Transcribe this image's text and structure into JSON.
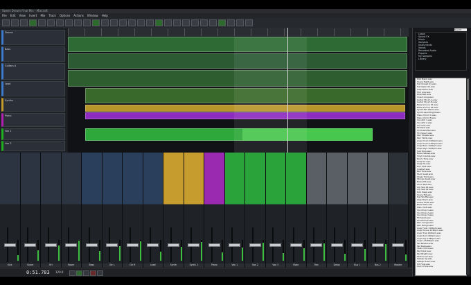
{
  "window": {
    "title": "Sweet Dream Final Mix - Mixcraft"
  },
  "menu": [
    "File",
    "Edit",
    "View",
    "Insert",
    "Mix",
    "Track",
    "Options",
    "Actions",
    "Window",
    "Help"
  ],
  "tracks": [
    {
      "name": "Drums",
      "color": "#3b7acb"
    },
    {
      "name": "Bass",
      "color": "#3b7acb"
    },
    {
      "name": "Guitars A",
      "color": "#3b7acb"
    },
    {
      "name": "Lead",
      "color": "#3b7acb"
    },
    {
      "name": "Synths",
      "color": "#c49b29"
    },
    {
      "name": "Piano",
      "color": "#b21fb1"
    },
    {
      "name": "Vox 1",
      "color": "#1fb21f"
    },
    {
      "name": "Vox 2",
      "color": "#1fb21f"
    }
  ],
  "browser": {
    "search_label": "Search",
    "tree": [
      "Loops",
      "Sound FX",
      "Music",
      "Samples",
      "Instruments",
      "Vocals",
      "Recorded Audio",
      "Exports",
      "My Samples",
      "Library"
    ],
    "files": [
      "Kick Basic.wav",
      "Snare Tight.wav",
      "Hat Closed 01.wav",
      "Hat Open 02.wav",
      "Clap Room.wav",
      "Tom Low.wav",
      "Ride Bell.wav",
      "Crash Long.wav",
      "Guitar Strum A.wav",
      "Guitar Strum B.wav",
      "Bass Groove 01.wav",
      "Bass Groove 02.wav",
      "Synth Pad Warm.wav",
      "Synth Lead Bright.wav",
      "Piano Chord C.wav",
      "Piano Chord F.wav",
      "Vox Ahh 1.wav",
      "Vox Ahh 2.wav",
      "Vox Ooh.wav",
      "FX Riser.wav",
      "FX Downlifter.wav",
      "FX Impact.wav",
      "Perc Shaker.wav",
      "Perc Tamb.wav",
      "Loop Drum 100bpm.wav",
      "Loop Drum 120bpm.wav",
      "Loop Bass 120bpm.wav",
      "Loop Keys 120bpm.wav",
      "Sub Drop.wav",
      "Noise Sweep.wav",
      "Vinyl Crackle.wav",
      "Room Tone.wav",
      "Snap 01.wav",
      "Snap 02.wav",
      "Rim Shot.wav",
      "Cowbell.wav",
      "Bell Tone.wav",
      "Pluck Lead.wav",
      "Organ Hold.wav",
      "Strings Swell.wav",
      "Brass Hit.wav",
      "Choir Pad.wav",
      "Arp Seq 01.wav",
      "Arp Seq 02.wav",
      "Kick Deep.wav",
      "Snare Fat.wav",
      "Hat Shuffle.wav",
      "Clap Stack.wav",
      "Guitar Mute.wav",
      "Bass Slide.wav",
      "Piano Soft.wav",
      "Vox Chop 1.wav",
      "Vox Chop 2.wav",
      "Vox Chop 3.wav",
      "FX Swell.wav",
      "FX Whoosh.wav",
      "Perc Conga.wav",
      "Perc Bongo.wav",
      "Loop Funk 110bpm.wav",
      "Loop House 124bpm.wav",
      "Loop Trap 140bpm.wav",
      "Loop Rock 96bpm.wav",
      "Loop Pop 118bpm.wav",
      "Loop Lofi 85bpm.wav",
      "Tail Reverb.wav",
      "Tail Delay.wav",
      "Stab Chord.wav",
      "Pad Dark.wav",
      "Pad Bright.wav",
      "Texture Air.wav",
      "Sweep Up.wav",
      "Sweep Down.wav",
      "Hit Final.wav",
      "Outro Fade.wav"
    ]
  },
  "mixer": {
    "strips": [
      {
        "name": "Kick",
        "color": "#2c3441"
      },
      {
        "name": "Snare",
        "color": "#2c3441"
      },
      {
        "name": "OH",
        "color": "#2c3441"
      },
      {
        "name": "Room",
        "color": "#2c3441"
      },
      {
        "name": "Bass",
        "color": "#2a3f5c"
      },
      {
        "name": "Gtr L",
        "color": "#2a3f5c"
      },
      {
        "name": "Gtr R",
        "color": "#2a3f5c"
      },
      {
        "name": "Lead",
        "color": "#2a3f5c"
      },
      {
        "name": "Synth",
        "color": "#c79c2e"
      },
      {
        "name": "Synth 2",
        "color": "#c79c2e"
      },
      {
        "name": "Piano",
        "color": "#9a2ab0"
      },
      {
        "name": "Vox 1",
        "color": "#2aa33a"
      },
      {
        "name": "Vox 2",
        "color": "#2aa33a"
      },
      {
        "name": "Vox 3",
        "color": "#2aa33a"
      },
      {
        "name": "BVox",
        "color": "#2aa33a"
      },
      {
        "name": "Rev",
        "color": "#5a5f66"
      },
      {
        "name": "Delay",
        "color": "#5a5f66"
      },
      {
        "name": "Bus 1",
        "color": "#5a5f66"
      },
      {
        "name": "Bus 2",
        "color": "#5a5f66"
      },
      {
        "name": "Master",
        "color": "#2c3138"
      }
    ]
  },
  "transport": {
    "timecode": "0:51.783",
    "tempo_label": "120.0"
  },
  "colors": {
    "green": "#3fbf3f",
    "yellow": "#d7b12a",
    "purple": "#9b32c8"
  }
}
